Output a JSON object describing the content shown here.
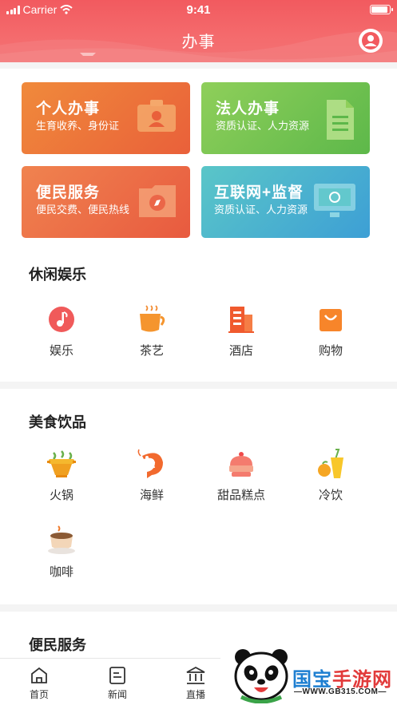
{
  "status": {
    "carrier": "Carrier",
    "time": "9:41"
  },
  "header": {
    "title": "办事",
    "user_icon": "user-circle-icon"
  },
  "cards": [
    {
      "title": "个人办事",
      "subtitle": "生育收养、身份证",
      "icon": "id-card-icon"
    },
    {
      "title": "法人办事",
      "subtitle": "资质认证、人力资源",
      "icon": "document-icon"
    },
    {
      "title": "便民服务",
      "subtitle": "便民交费、便民热线",
      "icon": "folder-compass-icon"
    },
    {
      "title": "互联网+监督",
      "subtitle": "资质认证、人力资源",
      "icon": "monitor-icon"
    }
  ],
  "leisure": {
    "title": "休闲娱乐",
    "items": [
      {
        "label": "娱乐",
        "icon": "music-note-icon"
      },
      {
        "label": "茶艺",
        "icon": "tea-cup-icon"
      },
      {
        "label": "酒店",
        "icon": "hotel-building-icon"
      },
      {
        "label": "购物",
        "icon": "shopping-bag-icon"
      }
    ]
  },
  "food": {
    "title": "美食饮品",
    "items": [
      {
        "label": "火锅",
        "icon": "hotpot-icon"
      },
      {
        "label": "海鲜",
        "icon": "shrimp-icon"
      },
      {
        "label": "甜品糕点",
        "icon": "cake-icon"
      },
      {
        "label": "冷饮",
        "icon": "cold-drink-icon"
      },
      {
        "label": "咖啡",
        "icon": "coffee-icon"
      }
    ]
  },
  "service": {
    "title": "便民服务"
  },
  "tabs": [
    {
      "label": "首页",
      "icon": "home-icon"
    },
    {
      "label": "新闻",
      "icon": "news-icon"
    },
    {
      "label": "直播",
      "icon": "institution-icon"
    }
  ],
  "watermark": {
    "brand_a": "国宝",
    "brand_b": "手游网",
    "url": "—WWW.GB315.COM—"
  },
  "colors": {
    "header": "#f25a5f",
    "accent": "#e9603a"
  }
}
